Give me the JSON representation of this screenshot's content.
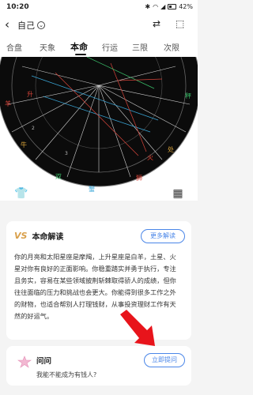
{
  "status": {
    "time": "10:20",
    "battery": "42%"
  },
  "header": {
    "back": "‹",
    "profile": "自己",
    "profile_chevron": "⌄",
    "swap_icon": "⇄",
    "share_icon": "⬚"
  },
  "tabs": [
    "合盘",
    "天象",
    "本命",
    "行运",
    "三限",
    "次限"
  ],
  "active_tab": "本命",
  "chart_labels": {
    "signs": [
      "羊",
      "牛",
      "双",
      "蟹",
      "狮",
      "处",
      "秤"
    ],
    "planets": [
      "火",
      "升"
    ],
    "house_numbers": [
      "2",
      "3"
    ]
  },
  "tools": {
    "shirt_icon": "👕",
    "grid_icon": "▦"
  },
  "reading": {
    "title": "本命解读",
    "badge": "VS",
    "more_button": "更多解读",
    "lines": [
      "你的月亮和太阳星座是摩羯，上升星座是白羊，土星、火",
      "星对你有良好的正面影响。你稳重踏实并勇于执行，专注",
      "且务实，容易在某些领域披荆斩棘取得骄人的成绩，但你",
      "往往面临的压力和挑战也会更大。你能得到很多工作之外",
      "的财物，也适合帮别人打理钱财，从事投资理财工作有天",
      "然的好运气。"
    ]
  },
  "ask": {
    "title": "问问",
    "button": "立即提问",
    "question": "我能不能成为有钱人?"
  },
  "colors": {
    "accent": "#4a86e8",
    "arrow": "#e8141b",
    "chart_bg": "#0b0b0b"
  }
}
